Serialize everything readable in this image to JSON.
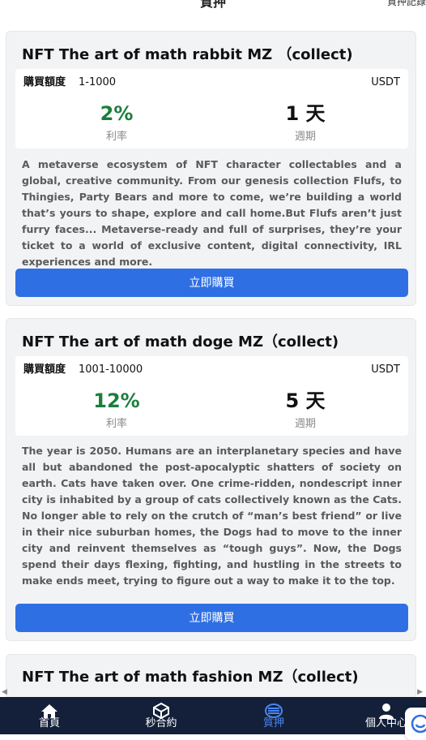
{
  "header": {
    "title": "質押",
    "right_link": "質押記錄"
  },
  "products": [
    {
      "title": "NFT The art of math rabbit MZ （collect)",
      "amount_label": "購買額度",
      "amount_range": "1-1000",
      "currency": "USDT",
      "rate": "2%",
      "rate_label": "利率",
      "period": "1 天",
      "period_label": "週期",
      "description": "A metaverse ecosystem of NFT character collectables and a global, creative community. From our genesis collection Flufs, to Thingies, Party Bears and more to come, we’re building a world that’s yours to shape, explore and call home.But Flufs aren’t just furry faces... Metaverse-ready and full of surprises, they’re your ticket to a world of exclusive content, digital connectivity, IRL experiences and more.",
      "button_label": "立即購買"
    },
    {
      "title": "NFT The art of math doge MZ（collect)",
      "amount_label": "購買額度",
      "amount_range": "1001-10000",
      "currency": "USDT",
      "rate": "12%",
      "rate_label": "利率",
      "period": "5 天",
      "period_label": "週期",
      "description": "The year is 2050. Humans are an interplanetary species and have all but abandoned the post-apocalyptic shatters of society on earth. Cats have taken over. One crime-ridden, nondescript inner city is inhabited by a group of cats collectively known as the Cats. No longer able to rely on the crutch of “man’s best friend” or live in their nice suburban homes, the Dogs had to move to the inner city and reinvent themselves as “tough guys”. Now, the Dogs spend their days flexing, fighting, and hustling in the streets to make ends meet, trying to figure out a way to make it to the top.",
      "button_label": "立即購買"
    },
    {
      "title": "NFT The art of math fashion MZ（collect)"
    }
  ],
  "bottom_nav": [
    {
      "label": "首頁",
      "icon": "home-icon",
      "active": false
    },
    {
      "label": "秒合約",
      "icon": "cube-icon",
      "active": false
    },
    {
      "label": "質押",
      "icon": "database-icon",
      "active": true
    },
    {
      "label": "個人中心",
      "icon": "user-icon",
      "active": false
    }
  ],
  "colors": {
    "rate_green": "#1a7f3c",
    "button_blue": "#2f6fe4",
    "nav_bg": "#14203a",
    "nav_active": "#4a86f0",
    "card_bg": "#f2f3f5"
  }
}
